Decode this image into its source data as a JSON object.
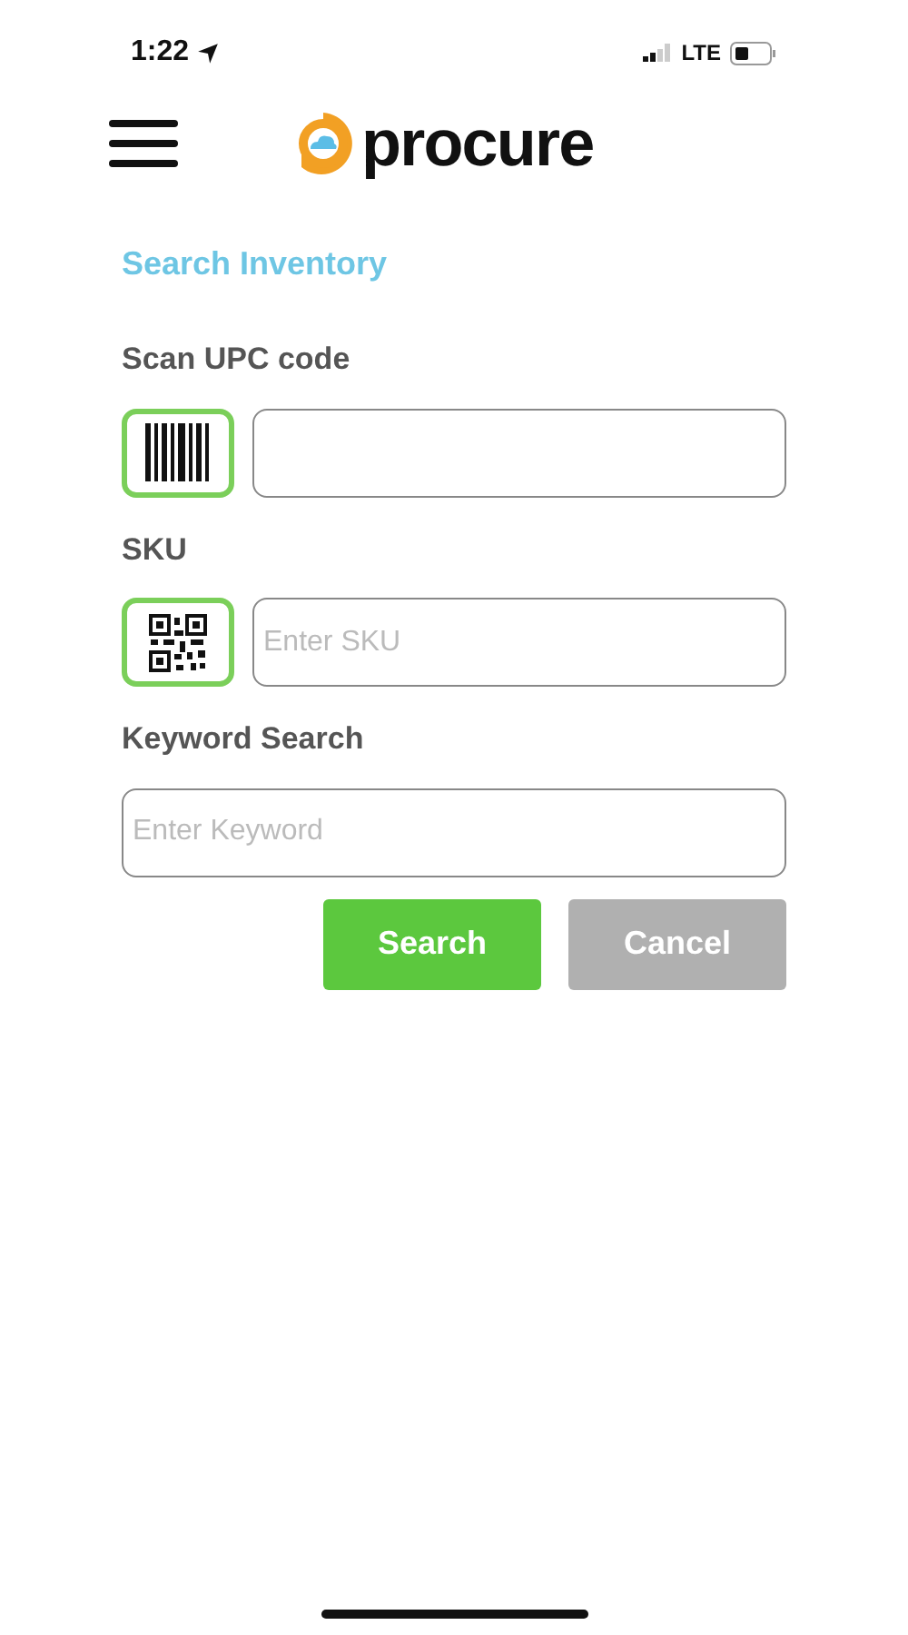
{
  "status_bar": {
    "time": "1:22",
    "network": "LTE"
  },
  "header": {
    "logo_text": "procure"
  },
  "title": "Search Inventory",
  "fields": [
    {
      "label": "Scan UPC code",
      "kind": "barcode"
    },
    {
      "label": "SKU",
      "kind": "qr",
      "placeholder": "Enter SKU"
    },
    {
      "label": "Keyword Search",
      "kind": "text",
      "placeholder": "Enter Keyword"
    }
  ],
  "buttons": [
    {
      "label": "Search",
      "disabled": false
    },
    {
      "label": "Cancel",
      "disabled": true
    }
  ]
}
